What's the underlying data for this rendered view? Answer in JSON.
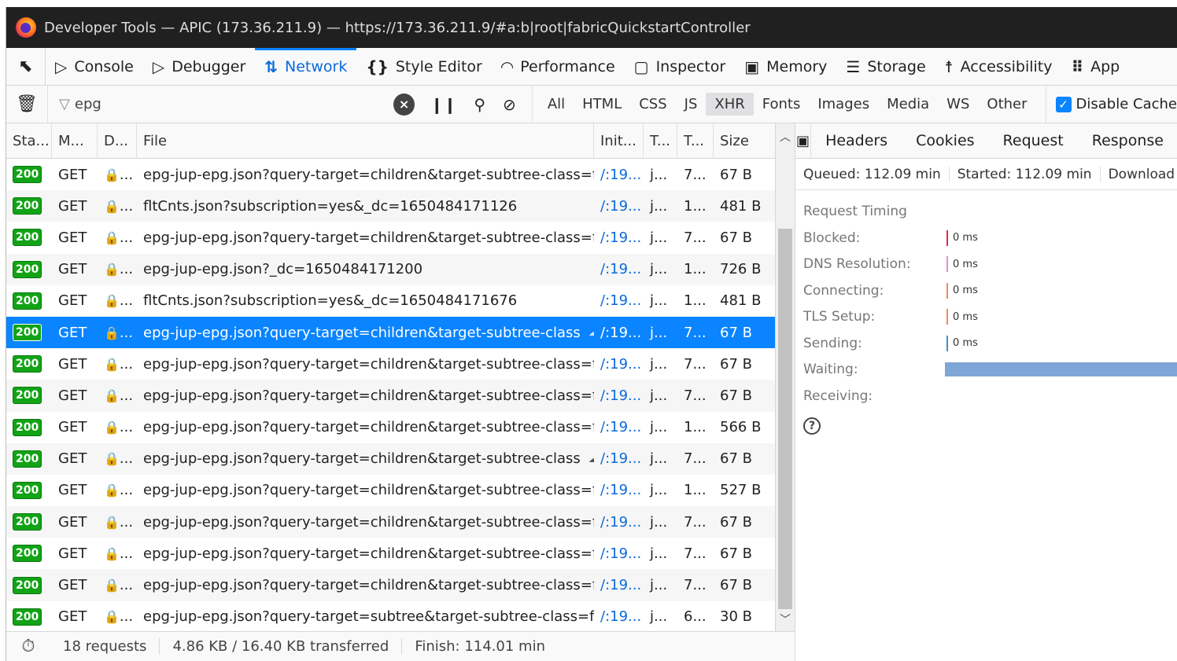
{
  "window": {
    "title": "Developer Tools — APIC (173.36.211.9) — https://173.36.211.9/#a:b|root|fabricQuickstartController"
  },
  "tabs": [
    {
      "label": "Console",
      "icon": "console-icon",
      "glyph": "▷"
    },
    {
      "label": "Debugger",
      "icon": "debugger-icon",
      "glyph": "▷"
    },
    {
      "label": "Network",
      "icon": "network-arrows-icon",
      "glyph": "⇅",
      "active": true
    },
    {
      "label": "Style Editor",
      "icon": "style-braces-icon",
      "glyph": "{}"
    },
    {
      "label": "Performance",
      "icon": "gauge-icon",
      "glyph": "◠"
    },
    {
      "label": "Inspector",
      "icon": "inspector-box-icon",
      "glyph": "▢"
    },
    {
      "label": "Memory",
      "icon": "chip-icon",
      "glyph": "▣"
    },
    {
      "label": "Storage",
      "icon": "storage-icon",
      "glyph": "☰"
    },
    {
      "label": "Accessibility",
      "icon": "person-icon",
      "glyph": "☨"
    },
    {
      "label": "App",
      "icon": "grid-dots-icon",
      "glyph": "⠿"
    }
  ],
  "filter": {
    "value": "epg"
  },
  "types": [
    "All",
    "HTML",
    "CSS",
    "JS",
    "XHR",
    "Fonts",
    "Images",
    "Media",
    "WS",
    "Other"
  ],
  "active_type": "XHR",
  "disable_cache": {
    "label": "Disable Cache",
    "checked": true
  },
  "columns": {
    "status": "Sta...",
    "method": "M...",
    "domain": "D...",
    "file": "File",
    "initiator": "Init...",
    "type": "T...",
    "transferred": "T...",
    "size": "Size"
  },
  "requests": [
    {
      "status": "200",
      "method": "GET",
      "domain": "...",
      "file": "epg-jup-epg.json?query-target=children&target-subtree-class=fvR",
      "initiator": "/:19...",
      "type": "j...",
      "transferred": "7...",
      "size": "67 B"
    },
    {
      "status": "200",
      "method": "GET",
      "domain": "...",
      "file": "fltCnts.json?subscription=yes&_dc=1650484171126",
      "initiator": "/:19...",
      "type": "j...",
      "transferred": "1...",
      "size": "481 B"
    },
    {
      "status": "200",
      "method": "GET",
      "domain": "...",
      "file": "epg-jup-epg.json?query-target=children&target-subtree-class=fvR",
      "initiator": "/:19...",
      "type": "j...",
      "transferred": "7...",
      "size": "67 B"
    },
    {
      "status": "200",
      "method": "GET",
      "domain": "...",
      "file": "epg-jup-epg.json?_dc=1650484171200",
      "initiator": "/:19...",
      "type": "j...",
      "transferred": "1...",
      "size": "726 B"
    },
    {
      "status": "200",
      "method": "GET",
      "domain": "...",
      "file": "fltCnts.json?subscription=yes&_dc=1650484171676",
      "initiator": "/:19...",
      "type": "j...",
      "transferred": "1...",
      "size": "481 B"
    },
    {
      "status": "200",
      "method": "GET",
      "domain": "...",
      "file": "epg-jup-epg.json?query-target=children&target-subtree-class",
      "initiator": "/:19...",
      "type": "j...",
      "transferred": "7...",
      "size": "67 B",
      "selected": true,
      "ws": true
    },
    {
      "status": "200",
      "method": "GET",
      "domain": "...",
      "file": "epg-jup-epg.json?query-target=children&target-subtree-class=fvR",
      "initiator": "/:19...",
      "type": "j...",
      "transferred": "7...",
      "size": "67 B"
    },
    {
      "status": "200",
      "method": "GET",
      "domain": "...",
      "file": "epg-jup-epg.json?query-target=children&target-subtree-class=fvR",
      "initiator": "/:19...",
      "type": "j...",
      "transferred": "7...",
      "size": "67 B"
    },
    {
      "status": "200",
      "method": "GET",
      "domain": "...",
      "file": "epg-jup-epg.json?query-target=children&target-subtree-class=fvR",
      "initiator": "/:19...",
      "type": "j...",
      "transferred": "1...",
      "size": "566 B"
    },
    {
      "status": "200",
      "method": "GET",
      "domain": "...",
      "file": "epg-jup-epg.json?query-target=children&target-subtree-class",
      "initiator": "/:19...",
      "type": "j...",
      "transferred": "7...",
      "size": "67 B",
      "ws": true
    },
    {
      "status": "200",
      "method": "GET",
      "domain": "...",
      "file": "epg-jup-epg.json?query-target=children&target-subtree-class=fvR",
      "initiator": "/:19...",
      "type": "j...",
      "transferred": "1...",
      "size": "527 B"
    },
    {
      "status": "200",
      "method": "GET",
      "domain": "...",
      "file": "epg-jup-epg.json?query-target=children&target-subtree-class=fvR",
      "initiator": "/:19...",
      "type": "j...",
      "transferred": "7...",
      "size": "67 B"
    },
    {
      "status": "200",
      "method": "GET",
      "domain": "...",
      "file": "epg-jup-epg.json?query-target=children&target-subtree-class=fvR",
      "initiator": "/:19...",
      "type": "j...",
      "transferred": "7...",
      "size": "67 B"
    },
    {
      "status": "200",
      "method": "GET",
      "domain": "...",
      "file": "epg-jup-epg.json?query-target=children&target-subtree-class=fvC",
      "initiator": "/:19...",
      "type": "j...",
      "transferred": "7...",
      "size": "67 B"
    },
    {
      "status": "200",
      "method": "GET",
      "domain": "...",
      "file": "epg-jup-epg.json?query-target=subtree&target-subtree-class=fvR",
      "initiator": "/:19...",
      "type": "j...",
      "transferred": "6...",
      "size": "30 B"
    }
  ],
  "statusbar": {
    "requests": "18 requests",
    "transferred": "4.86 KB / 16.40 KB transferred",
    "finish": "Finish: 114.01 min"
  },
  "details": {
    "tabs": [
      "Headers",
      "Cookies",
      "Request",
      "Response"
    ],
    "queued": "Queued: 112.09 min",
    "started": "Started: 112.09 min",
    "download": "Download",
    "timing_title": "Request Timing",
    "timings": [
      {
        "label": "Blocked:",
        "value": "0 ms",
        "color": "#e22850"
      },
      {
        "label": "DNS Resolution:",
        "value": "0 ms",
        "color": "#ee88dd"
      },
      {
        "label": "Connecting:",
        "value": "0 ms",
        "color": "#f08a56"
      },
      {
        "label": "TLS Setup:",
        "value": "0 ms",
        "color": "#f08a56"
      },
      {
        "label": "Sending:",
        "value": "0 ms",
        "color": "#3a8fd6"
      },
      {
        "label": "Waiting:",
        "value": "",
        "color": "#7ea6d6"
      },
      {
        "label": "Receiving:",
        "value": "",
        "color": ""
      }
    ]
  }
}
